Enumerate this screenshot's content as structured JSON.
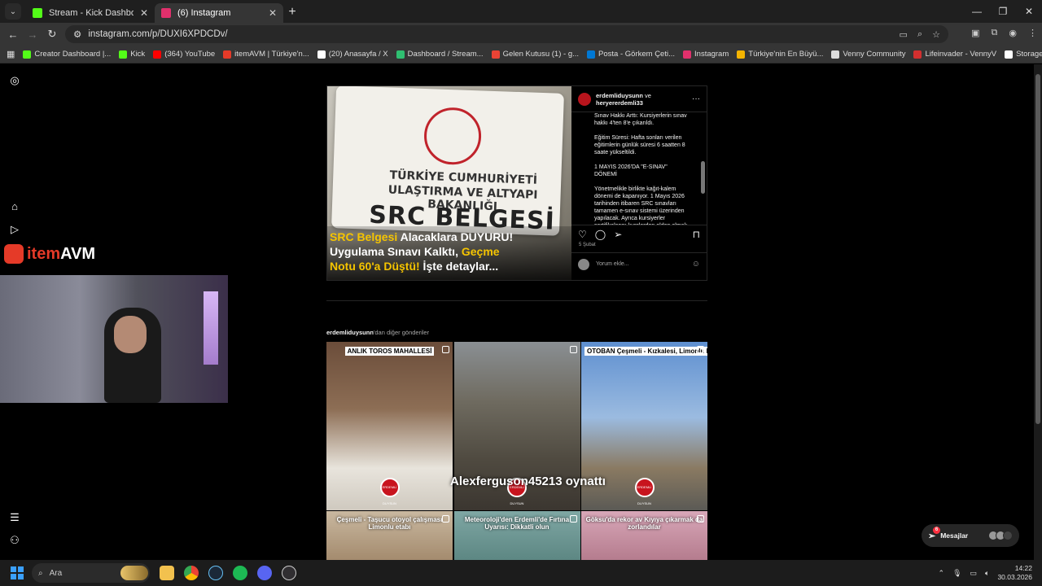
{
  "browser": {
    "tabs": [
      {
        "title": "Stream - Kick Dashboard",
        "favicon_color": "#53fc18",
        "active": false
      },
      {
        "title": "(6) Instagram",
        "favicon_color": "#e1306c",
        "active": true
      }
    ],
    "new_tab": "+",
    "url": "instagram.com/p/DUXI6XPDCDv/",
    "bookmarks": [
      {
        "label": "Creator Dashboard |...",
        "color": "#53fc18"
      },
      {
        "label": "Kick",
        "color": "#53fc18"
      },
      {
        "label": "(364) YouTube",
        "color": "#ff0000"
      },
      {
        "label": "itemAVM | Türkiye'n...",
        "color": "#e53a28"
      },
      {
        "label": "(20) Anasayfa / X",
        "color": "#ffffff"
      },
      {
        "label": "Dashboard / Stream...",
        "color": "#2fbf71"
      },
      {
        "label": "Gelen Kutusu (1) - g...",
        "color": "#ea4335"
      },
      {
        "label": "Posta - Görkem Çeti...",
        "color": "#0078d4"
      },
      {
        "label": "Instagram",
        "color": "#e1306c"
      },
      {
        "label": "Türkiye'nin En Büyü...",
        "color": "#f4b400"
      },
      {
        "label": "Venny Community",
        "color": "#dddddd"
      },
      {
        "label": "Lifeinvader - VennyV",
        "color": "#d32f2f"
      },
      {
        "label": "Storage | Fivemanage",
        "color": "#ffffff"
      }
    ]
  },
  "post": {
    "image": {
      "card_line1": "TÜRKİYE CUMHURİYETİ",
      "card_line2": "ULAŞTIRMA VE ALTYAPI BAKANLIĞI",
      "card_big": "SRC BELGESİ",
      "overlay_1a": "SRC Belgesi",
      "overlay_1b": " Alacaklara DUYURU!",
      "overlay_2a": "Uygulama ",
      "overlay_2b": "Sınavı Kalktı",
      "overlay_2c": ", ",
      "overlay_2d": "Geçme",
      "overlay_3a": "Notu 60'a Düştü!",
      "overlay_3b": " İşte detaylar..."
    },
    "user_1": "erdemliduysunn",
    "user_and": " ve",
    "user_2": "heryererdemli33",
    "caption": [
      "Sınav Hakkı Arttı: Kursiyerlerin sınav hakkı 4'ten 8'e çıkarıldı.",
      "Eğitim Süresi: Hafta sonları verilen eğitimlerin günlük süresi 6 saatten 8 saate yükseltildi.",
      "1 MAYIS 2026'DA \"E-SINAV\" DÖNEMİ",
      "Yönetmelikle birlikte kağıt-kalem dönemi de kapanıyor. 1 Mayıs 2026 tarihinden itibaren SRC sınavları tamamen e-sınav sistemi üzerinden yapılacak. Ayrıca kursiyerler sertifikalarını kurslardan elden almak yerine, e-Devlet üzerinden basvurdu"
    ],
    "date": "5 Şubat",
    "comment_placeholder": "Yorum ekle..."
  },
  "more_posts": {
    "user": "erdemliduysunn",
    "suffix": "'dan diğer gönderiler",
    "items": [
      {
        "caption": "ANLIK TOROS MAHALLESİ",
        "boxed": true
      },
      {
        "caption": "",
        "boxed": false
      },
      {
        "caption": "OTOBAN Çeşmeli - Kızkalesi, Limonlu Etabı",
        "boxed": true
      },
      {
        "caption": "Çeşmeli - Taşucu otoyol çalışması Limonlu etabı",
        "boxed": false
      },
      {
        "caption": "Meteoroloji'den Erdemli'de Fırtına Uyarısı: Dikkatli olun",
        "boxed": false
      },
      {
        "caption": "Göksu'da rekor av Kıyıya çıkarmak da zorlandılar",
        "boxed": false
      }
    ],
    "logo_text": "ERDEMLİ DUYSUN"
  },
  "stream": {
    "brand_a": "item",
    "brand_b": "AVM",
    "overlay_text": "Alexferguson45213 oynattı"
  },
  "messages": {
    "label": "Mesajlar",
    "badge": "6"
  },
  "taskbar": {
    "search": "Ara",
    "time": "14:22",
    "date": "30.03.2026"
  }
}
